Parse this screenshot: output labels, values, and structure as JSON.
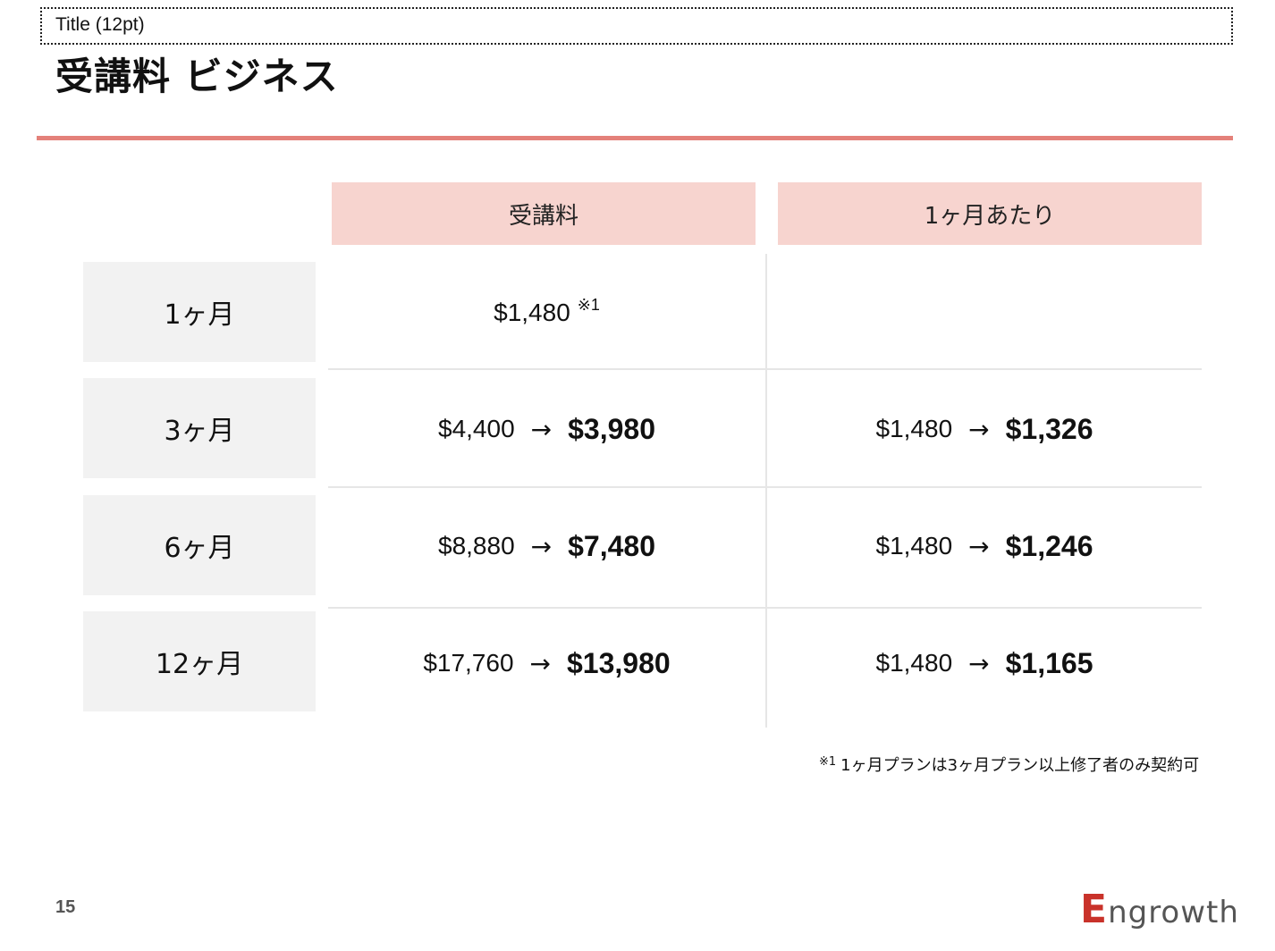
{
  "header": {
    "placeholder": "Title (12pt)",
    "title": "受講料 ビジネス"
  },
  "table": {
    "columns": [
      "受講料",
      "1ヶ月あたり"
    ],
    "rows": [
      {
        "label": "1ヶ月",
        "fee": {
          "price": "$1,480",
          "note": "※1"
        },
        "monthly": null
      },
      {
        "label": "3ヶ月",
        "fee": {
          "old": "$4,400",
          "new": "$3,980"
        },
        "monthly": {
          "old": "$1,480",
          "new": "$1,326"
        }
      },
      {
        "label": "6ヶ月",
        "fee": {
          "old": "$8,880",
          "new": "$7,480"
        },
        "monthly": {
          "old": "$1,480",
          "new": "$1,246"
        }
      },
      {
        "label": "12ヶ月",
        "fee": {
          "old": "$17,760",
          "new": "$13,980"
        },
        "monthly": {
          "old": "$1,480",
          "new": "$1,165"
        }
      }
    ],
    "arrow": "→"
  },
  "footnote": {
    "mark": "※1",
    "text": "1ヶ月プランは3ヶ月プラン以上修了者のみ契約可"
  },
  "footer": {
    "page_number": "15",
    "logo_initial": "E",
    "logo_rest": "ngrowth"
  },
  "colors": {
    "accent": "#e4817a",
    "header_fill": "#f7d4cf",
    "label_fill": "#f2f2f2",
    "logo_red": "#c9322a"
  }
}
